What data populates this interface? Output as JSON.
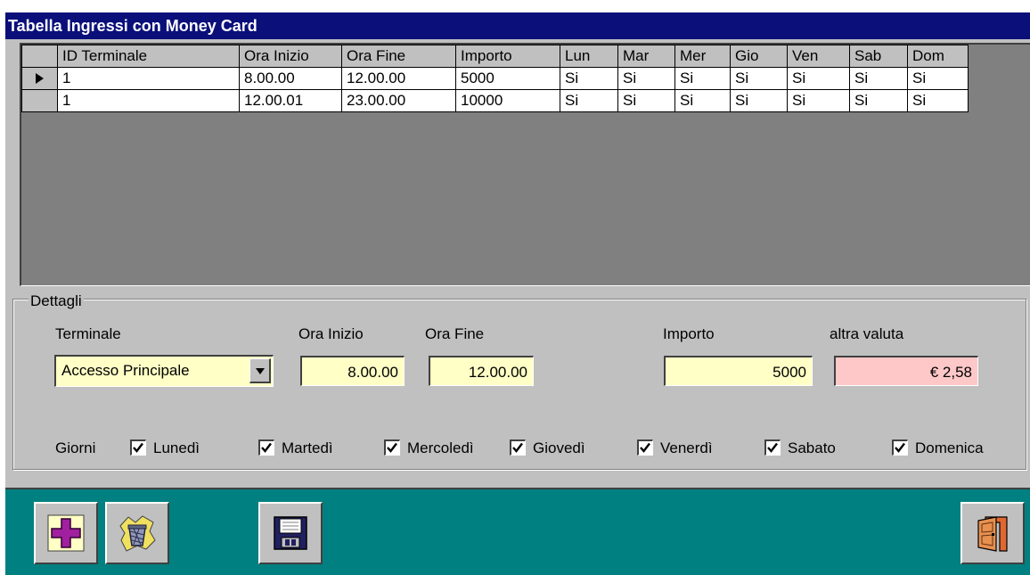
{
  "window": {
    "title": "Tabella Ingressi con Money Card"
  },
  "grid": {
    "columns": [
      "ID  Terminale",
      "Ora  Inizio",
      "Ora  Fine",
      "Importo",
      "Lun",
      "Mar",
      "Mer",
      "Gio",
      "Ven",
      "Sab",
      "Dom"
    ],
    "rows": [
      [
        "1",
        "8.00.00",
        "12.00.00",
        "5000",
        "Si",
        "Si",
        "Si",
        "Si",
        "Si",
        "Si",
        "Si"
      ],
      [
        "1",
        "12.00.01",
        "23.00.00",
        "10000",
        "Si",
        "Si",
        "Si",
        "Si",
        "Si",
        "Si",
        "Si"
      ]
    ],
    "current_row": 0
  },
  "details": {
    "legend": "Dettagli",
    "terminale_label": "Terminale",
    "terminale_value": "Accesso Principale",
    "ora_inizio_label": "Ora Inizio",
    "ora_inizio_value": "8.00.00",
    "ora_fine_label": "Ora Fine",
    "ora_fine_value": "12.00.00",
    "importo_label": "Importo",
    "importo_value": "5000",
    "altra_valuta_label": "altra valuta",
    "altra_valuta_value": "€ 2,58",
    "giorni_label": "Giorni",
    "days": [
      {
        "label": "Lunedì",
        "checked": true
      },
      {
        "label": "Martedì",
        "checked": true
      },
      {
        "label": "Mercoledì",
        "checked": true
      },
      {
        "label": "Giovedì",
        "checked": true
      },
      {
        "label": "Venerdì",
        "checked": true
      },
      {
        "label": "Sabato",
        "checked": true
      },
      {
        "label": "Domenica",
        "checked": true
      }
    ]
  },
  "colors": {
    "titlebar": "#0a0f7a",
    "toolbar": "#008080",
    "field_bg": "#ffffc6",
    "euro_bg": "#ffc8c8"
  },
  "toolbar": {
    "buttons": [
      "add-record-icon",
      "delete-record-icon",
      "save-floppy-icon",
      "exit-door-icon"
    ]
  }
}
